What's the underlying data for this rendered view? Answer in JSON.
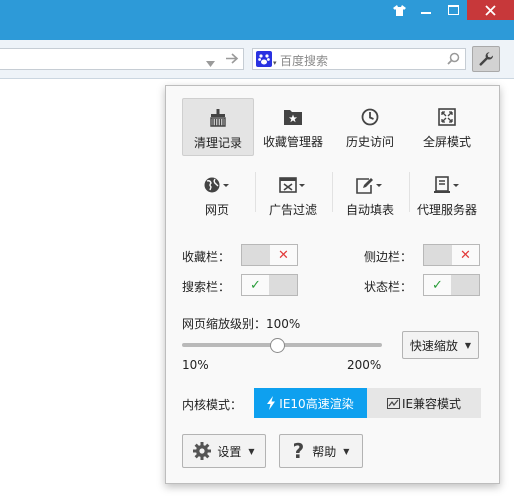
{
  "window": {
    "accent": "#2d9ad8",
    "controls": [
      "shirt-icon",
      "minimize-icon",
      "maximize-icon",
      "close-icon"
    ]
  },
  "addressbar": {
    "search_placeholder": "百度搜索",
    "search_engine_icon": "baidu-icon"
  },
  "tools": [
    {
      "label": "清理记录",
      "icon": "broom-icon"
    },
    {
      "label": "收藏管理器",
      "icon": "favorites-folder-icon"
    },
    {
      "label": "历史访问",
      "icon": "clock-icon"
    },
    {
      "label": "全屏模式",
      "icon": "fullscreen-icon"
    },
    {
      "label": "网页",
      "icon": "globe-icon"
    },
    {
      "label": "广告过滤",
      "icon": "ad-filter-icon"
    },
    {
      "label": "自动填表",
      "icon": "autofill-icon"
    },
    {
      "label": "代理服务器",
      "icon": "proxy-server-icon"
    }
  ],
  "toggles": {
    "favorites_bar": {
      "label": "收藏栏：",
      "on": false
    },
    "sidebar": {
      "label": "侧边栏：",
      "on": false
    },
    "search_bar": {
      "label": "搜索栏：",
      "on": true
    },
    "status_bar": {
      "label": "状态栏：",
      "on": true
    }
  },
  "zoom": {
    "label": "网页缩放级别：100%",
    "min_label": "10%",
    "max_label": "200%",
    "level": 0.4737,
    "quick_zoom_label": "快速缩放"
  },
  "engine": {
    "label": "内核模式：",
    "fast_label": "IE10高速渲染",
    "compat_label": "IE兼容模式",
    "active_color": "#0ea0ef"
  },
  "footer": {
    "settings_label": "设置",
    "help_label": "帮助"
  }
}
